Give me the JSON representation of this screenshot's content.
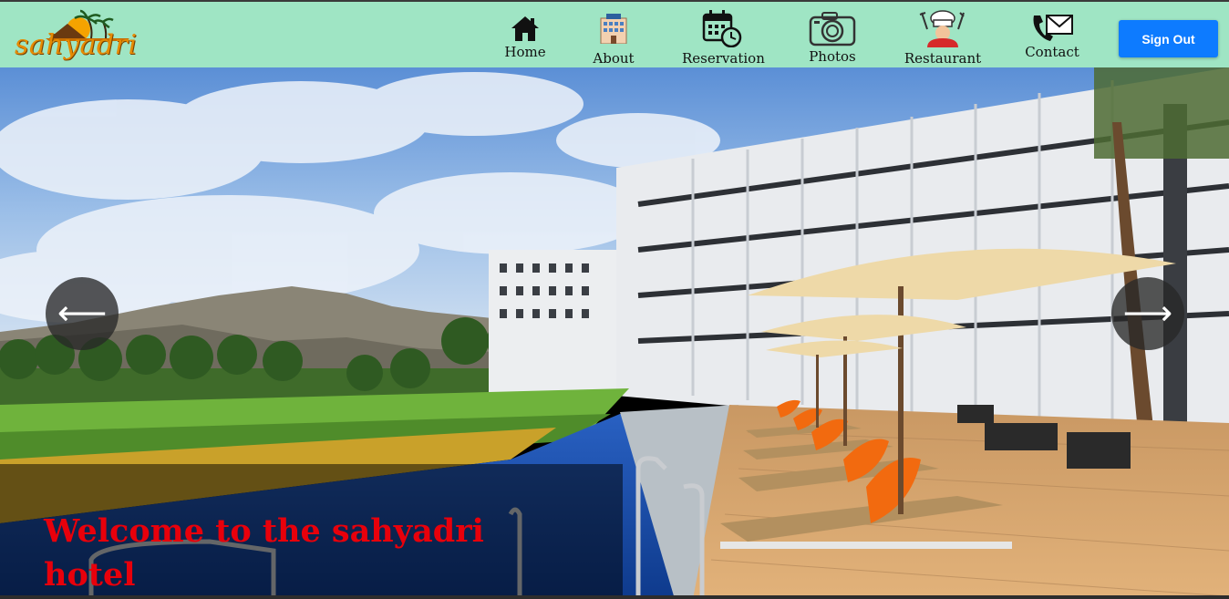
{
  "brand": {
    "logo_text": "sahyadri"
  },
  "nav": {
    "items": [
      {
        "label": "Home",
        "icon": "home-icon"
      },
      {
        "label": "About",
        "icon": "hotel-building-icon"
      },
      {
        "label": "Reservation",
        "icon": "calendar-clock-icon"
      },
      {
        "label": "Photos",
        "icon": "camera-icon"
      },
      {
        "label": "Restaurant",
        "icon": "chef-icon"
      },
      {
        "label": "Contact",
        "icon": "phone-mail-icon"
      }
    ],
    "signout_label": "Sign Out"
  },
  "hero": {
    "prev_arrow": "⟵",
    "next_arrow": "⟶",
    "caption": "Welcome to the sahyadri hotel"
  },
  "colors": {
    "navbar_bg": "#9fe5c4",
    "signout_bg": "#0d7bff",
    "caption_text": "#e8000b"
  }
}
